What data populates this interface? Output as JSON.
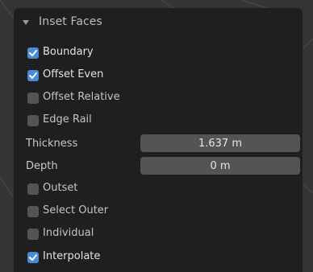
{
  "panel": {
    "title": "Inset Faces",
    "expanded": true
  },
  "options": [
    {
      "label": "Boundary",
      "checked": true
    },
    {
      "label": "Offset Even",
      "checked": true
    },
    {
      "label": "Offset Relative",
      "checked": false
    },
    {
      "label": "Edge Rail",
      "checked": false
    }
  ],
  "thickness": {
    "label": "Thickness",
    "value": "1.637 m"
  },
  "depth": {
    "label": "Depth",
    "value": "0 m"
  },
  "options2": [
    {
      "label": "Outset",
      "checked": false
    },
    {
      "label": "Select Outer",
      "checked": false
    },
    {
      "label": "Individual",
      "checked": false
    },
    {
      "label": "Interpolate",
      "checked": true
    }
  ],
  "colors": {
    "accent": "#4a8bd6",
    "panel_bg": "#1f1f1f",
    "field_bg": "#545454",
    "viewport_line": "#3f6b3a"
  }
}
